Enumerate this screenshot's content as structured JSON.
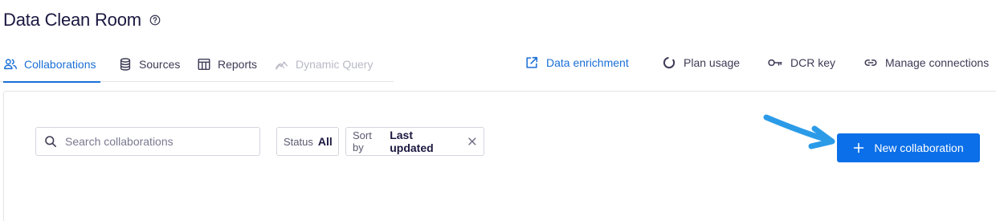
{
  "page": {
    "title": "Data Clean Room"
  },
  "icons": {
    "help": "help-circle-icon",
    "collaborations": "users-icon",
    "sources": "database-icon",
    "reports": "table-icon",
    "dynamic_query": "chart-line-icon",
    "data_enrichment": "external-link-icon",
    "plan_usage": "progress-ring-icon",
    "dcr_key": "key-icon",
    "manage_connections": "link-icon",
    "search": "search-icon",
    "clear": "close-icon",
    "add": "plus-icon"
  },
  "tabs": [
    {
      "label": "Collaborations",
      "active": true
    },
    {
      "label": "Sources"
    },
    {
      "label": "Reports"
    },
    {
      "label": "Dynamic Query",
      "disabled": true
    }
  ],
  "actions": [
    {
      "label": "Data enrichment"
    },
    {
      "label": "Plan usage"
    },
    {
      "label": "DCR key"
    },
    {
      "label": "Manage connections"
    }
  ],
  "search": {
    "placeholder": "Search collaborations",
    "value": ""
  },
  "filters": {
    "status": {
      "label": "Status",
      "value": "All"
    },
    "sort": {
      "label": "Sort by",
      "value": "Last updated"
    }
  },
  "buttons": {
    "new_collaboration": "New collaboration"
  },
  "colors": {
    "accent": "#1a6fd6",
    "primary_button": "#0a6fe8",
    "arrow": "#2b9be8",
    "title": "#1b1840"
  }
}
